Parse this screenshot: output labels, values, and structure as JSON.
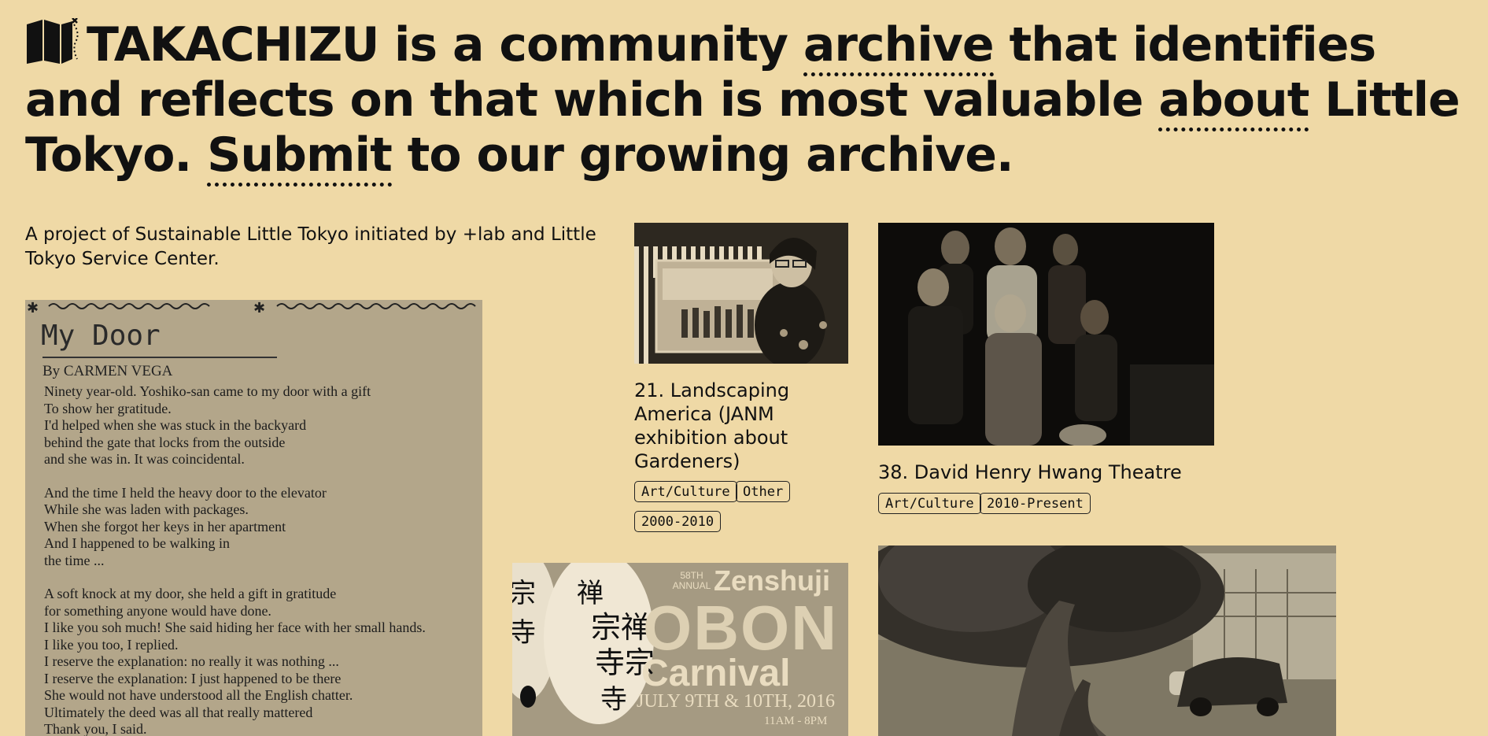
{
  "hero": {
    "brand": "TAKACHIZU",
    "part1": " is a community ",
    "link_archive": "archive",
    "part2": " that identifies and reflects on that which is most valuable ",
    "link_about": "about",
    "part3": " Little Tokyo. ",
    "link_submit": "Submit",
    "part4": " to our growing archive."
  },
  "tagline": "A project of Sustainable Little Tokyo initiated by +lab and Little Tokyo Service Center.",
  "poem": {
    "title": "My Door",
    "author": "By CARMEN VEGA",
    "stanza1": [
      "Ninety year-old. Yoshiko-san came to my door with a gift",
      "To show her gratitude.",
      "I'd helped when she was stuck in the backyard",
      "behind the gate that locks from the outside",
      "and she was in. It was coincidental."
    ],
    "stanza2": [
      "And the time I held the heavy door to the elevator",
      "While she was laden with packages.",
      "When she forgot her keys in her apartment",
      "And I happened to be walking in",
      "the time ..."
    ],
    "stanza3": [
      "A soft knock at my door, she held a gift in gratitude",
      "for something anyone would have done.",
      "I like you soh much! She said hiding her face with her small hands.",
      "I like you too, I replied.",
      "I reserve the explanation: no really it was nothing ...",
      "I reserve the explanation: I just happened to be there",
      "She would not have understood all the English chatter.",
      "Ultimately the deed was all that really mattered",
      "Thank you, I said."
    ]
  },
  "cards": [
    {
      "title": "21. Landscaping America (JANM exhibition about Gardeners)",
      "title_lines": [
        "21. Landscaping",
        "America (JANM",
        "exhibition about",
        "Gardeners)"
      ],
      "tags": [
        "Art/Culture",
        "Other",
        "2000-2010"
      ]
    },
    {
      "title": "38. David Henry Hwang Theatre",
      "tags": [
        "Art/Culture",
        "2010-Present"
      ]
    }
  ],
  "poster": {
    "annual": "58TH ANNUAL",
    "name": "Zenshuji",
    "obon": "OBON",
    "carnival": "Carnival",
    "dates": "JULY 9TH & 10TH, 2016",
    "hours": "11AM - 8PM"
  },
  "colors": {
    "background": "#efd9a6",
    "text": "#111111"
  }
}
